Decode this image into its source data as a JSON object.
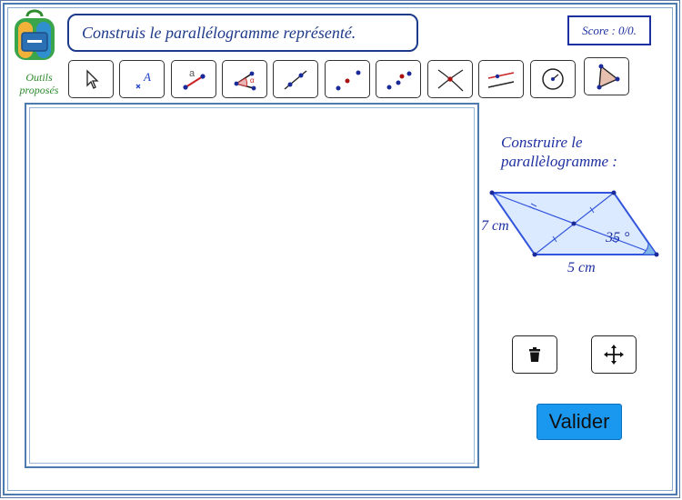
{
  "task": "Construis le parallélogramme représenté.",
  "score": "Score : 0/0.",
  "tools_label": [
    "Outils",
    "proposés"
  ],
  "toolbar": {
    "tools": [
      {
        "name": "move-tool",
        "icon": "arrow-pointer-icon"
      },
      {
        "name": "point-tool",
        "icon": "point-label-icon",
        "label": "A"
      },
      {
        "name": "segment-length-tool",
        "icon": "segment-length-icon",
        "label": "a"
      },
      {
        "name": "angle-tool",
        "icon": "angle-icon",
        "label": "α"
      },
      {
        "name": "line-tool",
        "icon": "line-icon"
      },
      {
        "name": "parallel-line-tool",
        "icon": "parallel-line-icon"
      },
      {
        "name": "perpendicular-line-tool",
        "icon": "perpendicular-line-icon"
      },
      {
        "name": "intersection-tool",
        "icon": "intersection-icon"
      },
      {
        "name": "parallel-lines-tool",
        "icon": "parallel-lines-icon"
      },
      {
        "name": "circle-tool",
        "icon": "circle-icon"
      },
      {
        "name": "polygon-tool",
        "icon": "polygon-icon"
      }
    ]
  },
  "instructions": {
    "line1": "Construire le",
    "line2": "parallèlogramme :"
  },
  "figure": {
    "side_label": "7 cm",
    "base_label": "5 cm",
    "angle_label": "35 °"
  },
  "actions": {
    "delete_icon": "trash-icon",
    "move_icon": "move-arrows-icon",
    "validate_label": "Valider"
  },
  "colors": {
    "title_blue": "#1e3a8a",
    "figure_blue": "#3355dd",
    "figure_fill": "#dbeafe",
    "validate_button": "#1a98f0",
    "tools_label_green": "#2d8a2d"
  }
}
